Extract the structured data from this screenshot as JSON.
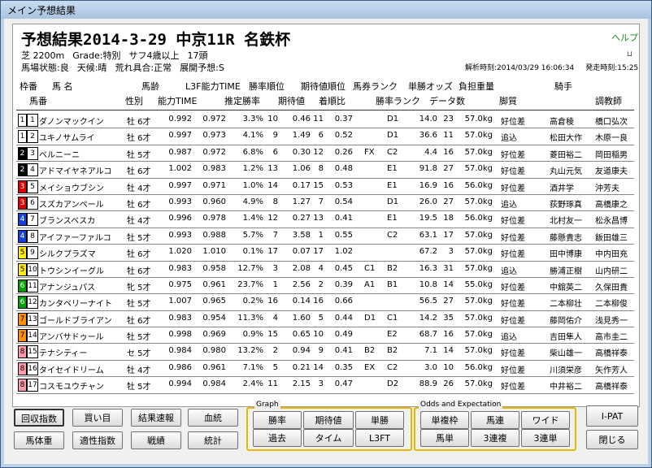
{
  "window": {
    "title": "メイン予想結果"
  },
  "header": {
    "race_title": "予想結果2014-3-29 中京11R 名鉄杯",
    "help_label": "ヘルプ",
    "course": "芝 2200m",
    "grade": "Grade:特別",
    "condition": "サフ4歳以上",
    "field_size": "17頭",
    "going": "馬場状態:良",
    "weather": "天候:晴",
    "rough": "荒れ具合:正常",
    "pace": "展開予想:S",
    "analysis_time": "解析時刻:2014/03/29 16:06:34",
    "post_time": "発走時刻:15:25"
  },
  "columns_top": [
    "枠番",
    "馬 名",
    "馬齢",
    "L3F能力TIME",
    "勝率順位",
    "期待値順位",
    "馬券ランク",
    "単勝オッズ",
    "負担重量",
    "騎手"
  ],
  "columns_bottom": [
    "馬番",
    "性別",
    "能力TIME",
    "推定勝率",
    "期待値",
    "着順比",
    "勝率ランク",
    "データ数",
    "脚質",
    "調教師"
  ],
  "horses": [
    {
      "frame": "1",
      "num": "1",
      "name": "ダノンマックイン",
      "sex_age": "牡 6才",
      "time": "0.992",
      "l3f": "0.972",
      "win": "3.3%",
      "wrank": "10",
      "ev": "0.46",
      "evrank": "11",
      "ratio": "0.37",
      "bet": "",
      "wr": "D1",
      "odds": "14.0",
      "cnt": "23",
      "wt": "57.0kg",
      "style": "好位差",
      "jockey": "高倉稜",
      "trainer": "橋口弘次"
    },
    {
      "frame": "1",
      "num": "2",
      "name": "ユキノサムライ",
      "sex_age": "牡 6才",
      "time": "0.997",
      "l3f": "0.973",
      "win": "4.1%",
      "wrank": "9",
      "ev": "1.49",
      "evrank": "6",
      "ratio": "0.52",
      "bet": "",
      "wr": "D1",
      "odds": "36.6",
      "cnt": "11",
      "wt": "57.0kg",
      "style": "追込",
      "jockey": "松田大作",
      "trainer": "木原一良"
    },
    {
      "frame": "2",
      "num": "3",
      "name": "ベルニーニ",
      "sex_age": "牡 5才",
      "time": "0.987",
      "l3f": "0.972",
      "win": "6.8%",
      "wrank": "6",
      "ev": "0.30",
      "evrank": "12",
      "ratio": "0.26",
      "bet": "FX",
      "wr": "C2",
      "odds": "4.4",
      "cnt": "16",
      "wt": "57.0kg",
      "style": "好位差",
      "jockey": "菱田裕二",
      "trainer": "岡田稲男"
    },
    {
      "frame": "2",
      "num": "4",
      "name": "アドマイヤネアルコ",
      "sex_age": "牡 6才",
      "time": "1.002",
      "l3f": "0.983",
      "win": "1.2%",
      "wrank": "13",
      "ev": "1.06",
      "evrank": "8",
      "ratio": "0.48",
      "bet": "",
      "wr": "E1",
      "odds": "91.8",
      "cnt": "27",
      "wt": "57.0kg",
      "style": "好位差",
      "jockey": "丸山元気",
      "trainer": "友道康夫"
    },
    {
      "frame": "3",
      "num": "5",
      "name": "メイショウブシン",
      "sex_age": "牡 4才",
      "time": "0.997",
      "l3f": "0.971",
      "win": "1.0%",
      "wrank": "14",
      "ev": "0.17",
      "evrank": "15",
      "ratio": "0.53",
      "bet": "",
      "wr": "E1",
      "odds": "16.9",
      "cnt": "16",
      "wt": "56.0kg",
      "style": "好位差",
      "jockey": "酒井学",
      "trainer": "沖芳夫"
    },
    {
      "frame": "3",
      "num": "6",
      "name": "スズカアンペール",
      "sex_age": "牡 6才",
      "time": "0.993",
      "l3f": "0.960",
      "win": "4.9%",
      "wrank": "8",
      "ev": "1.27",
      "evrank": "7",
      "ratio": "0.54",
      "bet": "",
      "wr": "D1",
      "odds": "26.0",
      "cnt": "27",
      "wt": "57.0kg",
      "style": "追込",
      "jockey": "荻野琢真",
      "trainer": "高橋康之"
    },
    {
      "frame": "4",
      "num": "7",
      "name": "ブランスベスカ",
      "sex_age": "牡 4才",
      "time": "0.996",
      "l3f": "0.978",
      "win": "1.4%",
      "wrank": "12",
      "ev": "0.27",
      "evrank": "13",
      "ratio": "0.41",
      "bet": "",
      "wr": "E1",
      "odds": "19.5",
      "cnt": "18",
      "wt": "56.0kg",
      "style": "好位差",
      "jockey": "北村友一",
      "trainer": "松永昌博"
    },
    {
      "frame": "4",
      "num": "8",
      "name": "アイファーファルコ",
      "sex_age": "牡 5才",
      "time": "0.993",
      "l3f": "0.988",
      "win": "5.7%",
      "wrank": "7",
      "ev": "3.58",
      "evrank": "1",
      "ratio": "0.55",
      "bet": "",
      "wr": "C2",
      "odds": "63.1",
      "cnt": "17",
      "wt": "57.0kg",
      "style": "好位差",
      "jockey": "藤懸貴志",
      "trainer": "飯田雄三"
    },
    {
      "frame": "5",
      "num": "9",
      "name": "シルクプラズマ",
      "sex_age": "牡 6才",
      "time": "1.020",
      "l3f": "1.010",
      "win": "0.1%",
      "wrank": "17",
      "ev": "0.07",
      "evrank": "17",
      "ratio": "1.02",
      "bet": "",
      "wr": "",
      "odds": "67.2",
      "cnt": "3",
      "wt": "57.0kg",
      "style": "好位差",
      "jockey": "田中博康",
      "trainer": "中内田充"
    },
    {
      "frame": "5",
      "num": "10",
      "name": "トウシンイーグル",
      "sex_age": "牡 6才",
      "time": "0.983",
      "l3f": "0.958",
      "win": "12.7%",
      "wrank": "3",
      "ev": "2.08",
      "evrank": "4",
      "ratio": "0.45",
      "bet": "C1",
      "wr": "B2",
      "odds": "16.3",
      "cnt": "31",
      "wt": "57.0kg",
      "style": "追込",
      "jockey": "勝浦正樹",
      "trainer": "山内研二"
    },
    {
      "frame": "6",
      "num": "11",
      "name": "アナンジュパス",
      "sex_age": "牝 5才",
      "time": "0.975",
      "l3f": "0.961",
      "win": "23.7%",
      "wrank": "1",
      "ev": "2.56",
      "evrank": "2",
      "ratio": "0.39",
      "bet": "A1",
      "wr": "B1",
      "odds": "10.8",
      "cnt": "14",
      "wt": "55.0kg",
      "style": "好位差",
      "jockey": "中舘英二",
      "trainer": "久保田貴"
    },
    {
      "frame": "6",
      "num": "12",
      "name": "カンタベリーナイト",
      "sex_age": "牡 5才",
      "time": "1.007",
      "l3f": "0.965",
      "win": "0.2%",
      "wrank": "16",
      "ev": "0.14",
      "evrank": "16",
      "ratio": "0.66",
      "bet": "",
      "wr": "",
      "odds": "56.5",
      "cnt": "27",
      "wt": "57.0kg",
      "style": "好位差",
      "jockey": "二本柳壮",
      "trainer": "二本柳俊"
    },
    {
      "frame": "7",
      "num": "13",
      "name": "ゴールドブライアン",
      "sex_age": "牡 6才",
      "time": "0.983",
      "l3f": "0.954",
      "win": "11.3%",
      "wrank": "4",
      "ev": "1.60",
      "evrank": "5",
      "ratio": "0.44",
      "bet": "D1",
      "wr": "C1",
      "odds": "14.2",
      "cnt": "35",
      "wt": "57.0kg",
      "style": "好位差",
      "jockey": "藤岡佑介",
      "trainer": "浅見秀一"
    },
    {
      "frame": "7",
      "num": "14",
      "name": "アンバサドゥール",
      "sex_age": "牡 5才",
      "time": "0.998",
      "l3f": "0.969",
      "win": "0.9%",
      "wrank": "15",
      "ev": "0.65",
      "evrank": "10",
      "ratio": "0.49",
      "bet": "",
      "wr": "E2",
      "odds": "68.7",
      "cnt": "16",
      "wt": "57.0kg",
      "style": "追込",
      "jockey": "吉田隼人",
      "trainer": "高市圭二"
    },
    {
      "frame": "8",
      "num": "15",
      "name": "テナシティー",
      "sex_age": "セ 5才",
      "time": "0.984",
      "l3f": "0.980",
      "win": "13.2%",
      "wrank": "2",
      "ev": "0.94",
      "evrank": "9",
      "ratio": "0.41",
      "bet": "B2",
      "wr": "B2",
      "odds": "7.1",
      "cnt": "14",
      "wt": "57.0kg",
      "style": "好位差",
      "jockey": "柴山雄一",
      "trainer": "高橋祥泰"
    },
    {
      "frame": "8",
      "num": "16",
      "name": "タイセイドリーム",
      "sex_age": "牡 4才",
      "time": "0.986",
      "l3f": "0.961",
      "win": "7.1%",
      "wrank": "5",
      "ev": "0.21",
      "evrank": "14",
      "ratio": "0.35",
      "bet": "EX",
      "wr": "C2",
      "odds": "3.0",
      "cnt": "10",
      "wt": "56.0kg",
      "style": "好位差",
      "jockey": "川須栄彦",
      "trainer": "矢作芳人"
    },
    {
      "frame": "8",
      "num": "17",
      "name": "コスモユウチャン",
      "sex_age": "牡 5才",
      "time": "0.994",
      "l3f": "0.984",
      "win": "2.4%",
      "wrank": "11",
      "ev": "2.15",
      "evrank": "3",
      "ratio": "0.47",
      "bet": "",
      "wr": "D2",
      "odds": "88.9",
      "cnt": "26",
      "wt": "57.0kg",
      "style": "好位差",
      "jockey": "中井裕二",
      "trainer": "高橋祥泰"
    }
  ],
  "frame_colors": {
    "1": "#ffffff",
    "2": "#000000",
    "3": "#e00000",
    "4": "#1040e0",
    "5": "#ffee00",
    "6": "#00a000",
    "7": "#ff9000",
    "8": "#ff9aa8"
  },
  "frame_text_colors": {
    "1": "#000000",
    "2": "#ffffff",
    "3": "#ffffff",
    "4": "#ffffff",
    "5": "#000000",
    "6": "#ffffff",
    "7": "#000000",
    "8": "#000000"
  },
  "buttons": {
    "recovery": "回収指数",
    "bought": "買い目",
    "result_report": "結果速報",
    "pedigree": "血統",
    "horse_weight": "馬体重",
    "aptitude": "適性指数",
    "record": "戦績",
    "stats": "統計",
    "graph_label": "Graph",
    "g_win": "勝率",
    "g_ev": "期待値",
    "g_tansho": "単勝",
    "g_past": "過去",
    "g_time": "タイム",
    "g_l3ft": "L3FT",
    "odds_label": "Odds and Expectation",
    "o_wakuren": "単複枠",
    "o_umaren": "馬連",
    "o_wide": "ワイド",
    "o_umatan": "馬単",
    "o_sanrenpuku": "3連複",
    "o_sanrentan": "3連単",
    "ipat": "I-PAT",
    "close": "閉じる"
  }
}
